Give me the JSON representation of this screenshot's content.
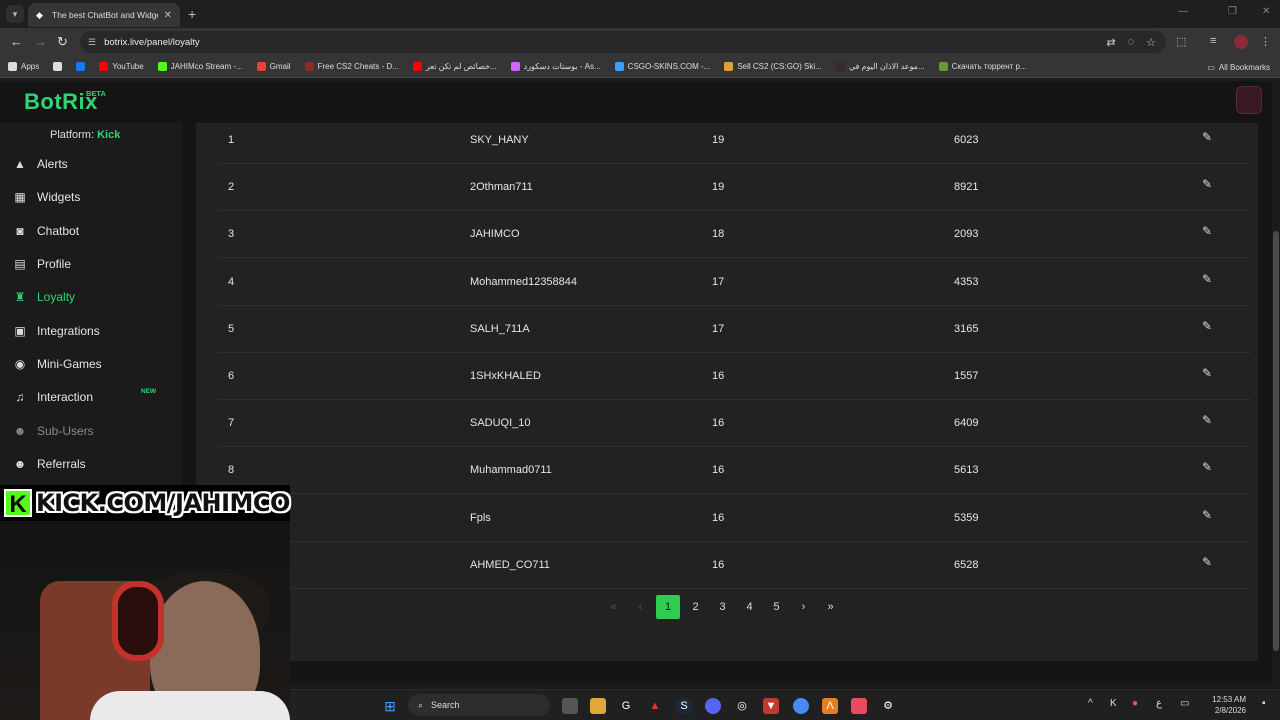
{
  "browser": {
    "tab_title": "The best ChatBot and Widgets for Kick",
    "url": "botrix.live/panel/loyalty",
    "bookmarks": [
      {
        "label": "Apps",
        "icon": "apps-grid-icon",
        "color": "#dddddd"
      },
      {
        "label": "",
        "icon": "grid-icon",
        "color": "#dddddd"
      },
      {
        "label": "",
        "icon": "facebook-icon",
        "color": "#1877f2"
      },
      {
        "label": "YouTube",
        "icon": "youtube-icon",
        "color": "#ff0000"
      },
      {
        "label": "JAHIMco Stream -...",
        "icon": "kick-icon",
        "color": "#53fc18"
      },
      {
        "label": "Gmail",
        "icon": "gmail-icon",
        "color": "#ea4335"
      },
      {
        "label": "Free CS2 Cheats - D...",
        "icon": "cheats-site-icon",
        "color": "#8a2a2a"
      },
      {
        "label": "خصائص لم تكن تعر...",
        "icon": "youtube-icon",
        "color": "#ff0000"
      },
      {
        "label": "بوستات دسكورد - As...",
        "icon": "gem-icon",
        "color": "#d066ff"
      },
      {
        "label": "CSGO-SKINS.COM -...",
        "icon": "csgo-skins-icon",
        "color": "#3aa0ff"
      },
      {
        "label": "Sell CS2 (CS:GO) Ski...",
        "icon": "skins-market-icon",
        "color": "#e0a040"
      },
      {
        "label": "موعد الاذان اليوم في...",
        "icon": "prayer-times-icon",
        "color": "#3a2a2a"
      },
      {
        "label": "Скачать торрент р...",
        "icon": "torrent-icon",
        "color": "#6a9a2a"
      }
    ],
    "all_bookmarks": "All Bookmarks"
  },
  "app": {
    "logo": "BotRix",
    "beta": "BETA",
    "platform_label": "Platform:",
    "platform_value": "Kick",
    "accent_color": "#2ed573"
  },
  "sidebar": {
    "items": [
      {
        "label": "Alerts",
        "icon": "warning-icon"
      },
      {
        "label": "Widgets",
        "icon": "widgets-grid-icon"
      },
      {
        "label": "Chatbot",
        "icon": "robot-icon"
      },
      {
        "label": "Profile",
        "icon": "id-card-icon"
      },
      {
        "label": "Loyalty",
        "icon": "trophy-icon",
        "active": true
      },
      {
        "label": "Integrations",
        "icon": "integrations-icon"
      },
      {
        "label": "Mini-Games",
        "icon": "gamepad-icon"
      },
      {
        "label": "Interaction",
        "icon": "music-note-icon",
        "badge": "NEW"
      },
      {
        "label": "Sub-Users",
        "icon": "users-icon",
        "disabled": true
      },
      {
        "label": "Referrals",
        "icon": "referrals-icon"
      }
    ]
  },
  "table": {
    "rows": [
      {
        "rank": "1",
        "name": "SKY_HANY",
        "level": "19",
        "points": "6023"
      },
      {
        "rank": "2",
        "name": "2Othman711",
        "level": "19",
        "points": "8921"
      },
      {
        "rank": "3",
        "name": "JAHIMCO",
        "level": "18",
        "points": "2093"
      },
      {
        "rank": "4",
        "name": "Mohammed12358844",
        "level": "17",
        "points": "4353"
      },
      {
        "rank": "5",
        "name": "SALH_711A",
        "level": "17",
        "points": "3165"
      },
      {
        "rank": "6",
        "name": "1SHxKHALED",
        "level": "16",
        "points": "1557"
      },
      {
        "rank": "7",
        "name": "SADUQI_10",
        "level": "16",
        "points": "6409"
      },
      {
        "rank": "8",
        "name": "Muhammad0711",
        "level": "16",
        "points": "5613"
      },
      {
        "rank": "",
        "name": "Fpls",
        "level": "16",
        "points": "5359"
      },
      {
        "rank": "",
        "name": "AHMED_CO711",
        "level": "16",
        "points": "6528"
      }
    ]
  },
  "pagination": {
    "first": "«",
    "prev": "‹",
    "pages": [
      "1",
      "2",
      "3",
      "4",
      "5"
    ],
    "current": "1",
    "next": "›",
    "last": "»"
  },
  "overlay": {
    "kick_logo": "K",
    "banner_text": "KICK.COM/JAHIMCO"
  },
  "taskbar": {
    "search_label": "Search",
    "lang": "ع",
    "time": "12:53 AM",
    "date": "2/8/2026"
  }
}
